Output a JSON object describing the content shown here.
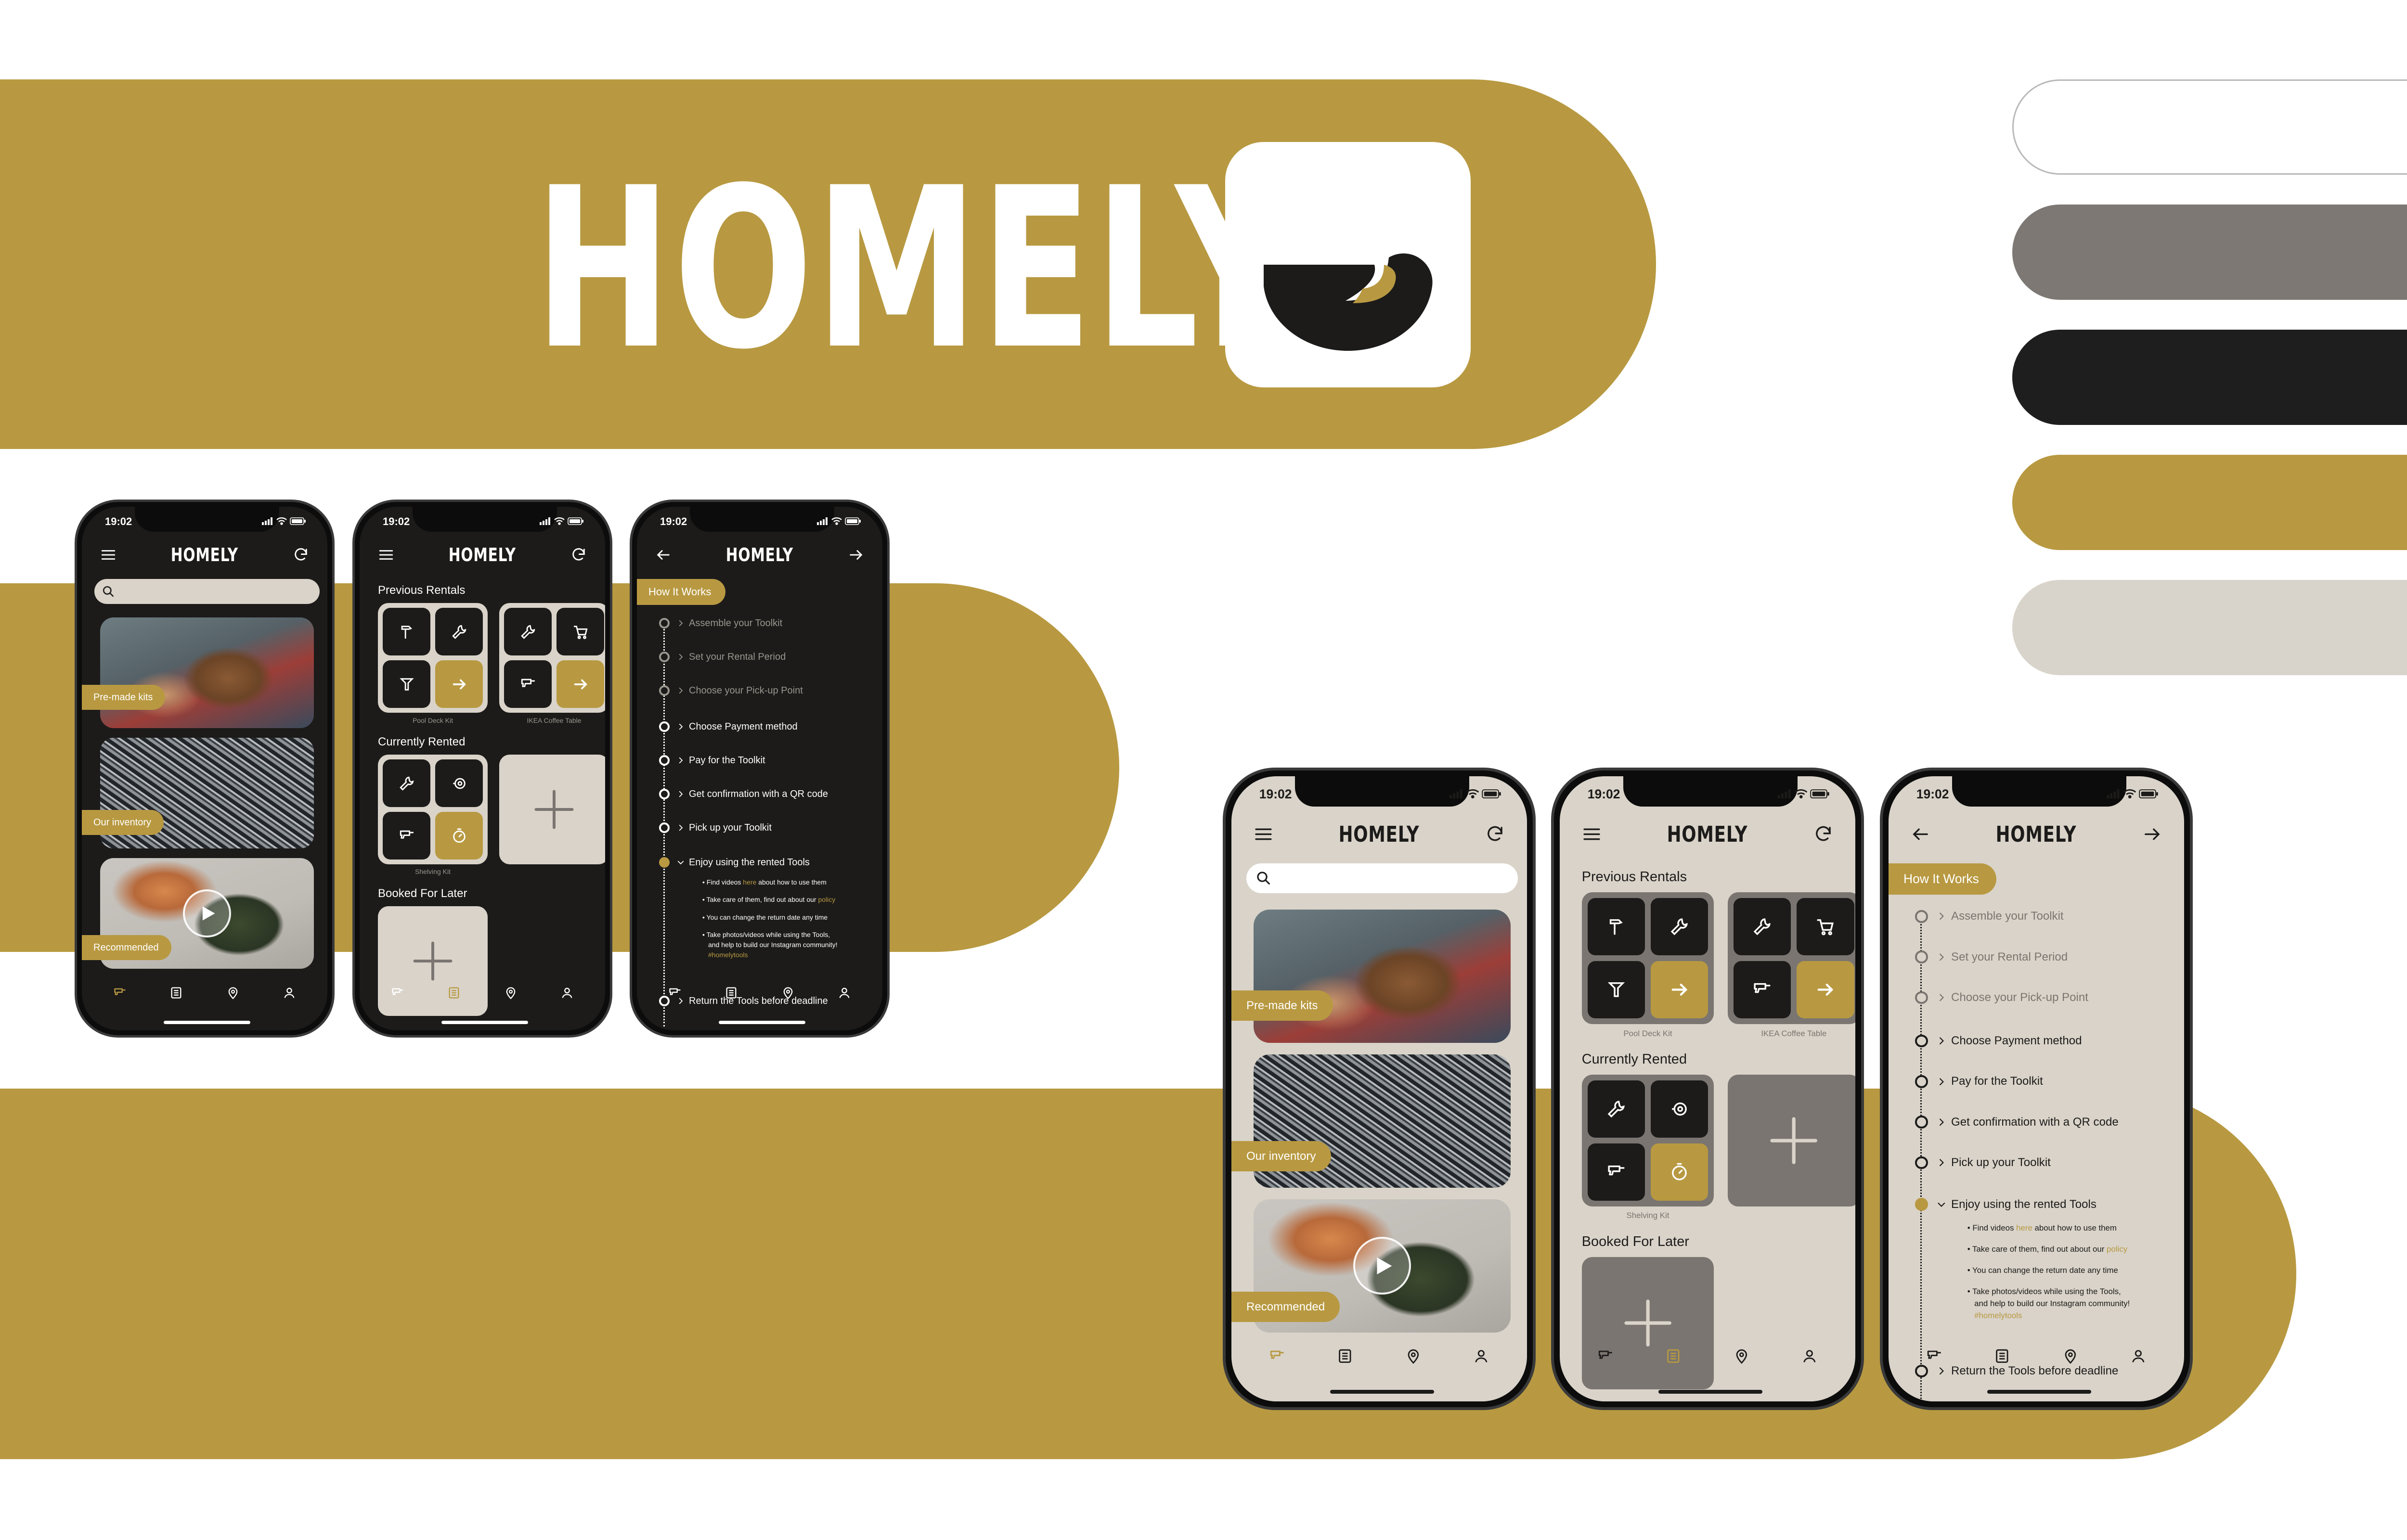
{
  "brand": {
    "wordmark": "HOMELY",
    "colors": {
      "gold": "#b89941",
      "dark": "#1c1b1a",
      "beige": "#d9d3c9",
      "gray": "#7a7570",
      "white": "#ffffff"
    }
  },
  "palette": [
    "#ffffff",
    "#7d7873",
    "#1e1e1e",
    "#b89941",
    "#d9d4cb"
  ],
  "phone": {
    "status_time": "19:02",
    "app_title": "HOMELY",
    "home": {
      "search_placeholder": "",
      "cards": [
        {
          "label": "Pre-made kits"
        },
        {
          "label": "Our inventory"
        },
        {
          "label": "Recommended"
        }
      ]
    },
    "rentals": {
      "previous_title": "Previous Rentals",
      "kits": [
        {
          "label": "Pool Deck Kit"
        },
        {
          "label": "IKEA Coffee Table"
        }
      ],
      "current_title": "Currently Rented",
      "current_kit_label": "Shelving Kit",
      "booked_title": "Booked For Later"
    },
    "how": {
      "title": "How It Works",
      "steps": [
        {
          "label": "Assemble your Toolkit",
          "done": true
        },
        {
          "label": "Set your Rental Period",
          "done": true
        },
        {
          "label": "Choose your Pick-up Point",
          "done": true
        },
        {
          "label": "Choose Payment method",
          "done": false
        },
        {
          "label": "Pay for the Toolkit",
          "done": false
        },
        {
          "label": "Get confirmation with a QR code",
          "done": false
        },
        {
          "label": "Pick up your Toolkit",
          "done": false
        },
        {
          "label": "Enjoy using the rented Tools",
          "done": false
        }
      ],
      "bullet_1_pre": "Find videos ",
      "bullet_1_link": "here",
      "bullet_1_post": " about how to use them",
      "bullet_2_pre": "Take care of them, find out about our ",
      "bullet_2_link": "policy",
      "bullet_3": "You can change the return date any time",
      "bullet_4a": "Take photos/videos while using the Tools,",
      "bullet_4b": "and help to build our Instagram community!",
      "bullet_4_tag": "#homelytools",
      "last_step": "Return the Tools before deadline"
    }
  }
}
